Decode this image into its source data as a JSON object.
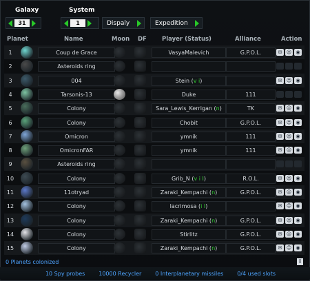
{
  "controls": {
    "galaxy_label": "Galaxy",
    "system_label": "System",
    "galaxy_value": "31",
    "system_value": "1",
    "display_label": "Dispaly",
    "expedition_label": "Expedition"
  },
  "headers": {
    "planet": "Planet",
    "name": "Name",
    "moon": "Moon",
    "df": "DF",
    "player": "Player (Status)",
    "alliance": "Alliance",
    "action": "Action"
  },
  "rows": [
    {
      "pos": "1",
      "name": "Coup de Grace",
      "moon": false,
      "player": "VasyaMalevich",
      "status": "",
      "alliance": "G.P.O.L.",
      "actions": true,
      "planet_color": "#6fd6d0"
    },
    {
      "pos": "2",
      "name": "Asteroids ring",
      "moon": false,
      "player": "",
      "status": "",
      "alliance": "",
      "actions": false,
      "planet_color": "#4a4a4a"
    },
    {
      "pos": "3",
      "name": "004",
      "moon": false,
      "player": "Stein",
      "status": "v i",
      "alliance": "",
      "actions": true,
      "planet_color": "#3d5a6a"
    },
    {
      "pos": "4",
      "name": "Tarsonis-13",
      "moon": true,
      "player": "Duke",
      "status": "",
      "alliance": "111",
      "actions": false,
      "planet_color": "#7dc4a2"
    },
    {
      "pos": "5",
      "name": "Colony",
      "moon": false,
      "player": "Sara_Lewis_Kerrigan",
      "status": "n",
      "alliance": "TK",
      "actions": true,
      "planet_color": "#4a6e5c"
    },
    {
      "pos": "6",
      "name": "Colony",
      "moon": false,
      "player": "Chobit",
      "status": "",
      "alliance": "G.P.O.L.",
      "actions": true,
      "planet_color": "#5aa27a"
    },
    {
      "pos": "7",
      "name": "Omicron",
      "moon": false,
      "player": "ymnik",
      "status": "",
      "alliance": "111",
      "actions": true,
      "planet_color": "#7fa6d8"
    },
    {
      "pos": "8",
      "name": "OmicronFAR",
      "moon": false,
      "player": "ymnik",
      "status": "",
      "alliance": "111",
      "actions": true,
      "planet_color": "#6fa07a"
    },
    {
      "pos": "9",
      "name": "Asteroids ring",
      "moon": false,
      "player": "",
      "status": "",
      "alliance": "",
      "actions": false,
      "planet_color": "#5a5040"
    },
    {
      "pos": "10",
      "name": "Colony",
      "moon": false,
      "player": "Grib_N",
      "status": "v i I",
      "alliance": "R.O.L.",
      "actions": true,
      "planet_color": "#3d4a52"
    },
    {
      "pos": "11",
      "name": "11otryad",
      "moon": false,
      "player": "Zaraki_Kempachi",
      "status": "n",
      "alliance": "G.P.O.L.",
      "actions": true,
      "planet_color": "#5b78c8"
    },
    {
      "pos": "12",
      "name": "Colony",
      "moon": false,
      "player": "lacrimosa",
      "status": "i I",
      "alliance": "",
      "actions": true,
      "planet_color": "#a4c2e0"
    },
    {
      "pos": "13",
      "name": "Colony",
      "moon": false,
      "player": "Zaraki_Kempachi",
      "status": "n",
      "alliance": "G.P.O.L.",
      "actions": true,
      "planet_color": "#1e3a5a"
    },
    {
      "pos": "14",
      "name": "Colony",
      "moon": false,
      "player": "Stirlitz",
      "status": "",
      "alliance": "G.P.O.L.",
      "actions": true,
      "planet_color": "#e4e4e8"
    },
    {
      "pos": "15",
      "name": "Colony",
      "moon": false,
      "player": "Zaraki_Kempachi",
      "status": "n",
      "alliance": "G.P.O.L.",
      "actions": true,
      "planet_color": "#c2cde6"
    }
  ],
  "footer": {
    "colonized": "0 Planets colonized",
    "info": "i",
    "spy_probes": "10 Spy probes",
    "recycler": "10000 Recycler",
    "missiles": "0 Interplanetary missiles",
    "slots": "0/4 used slots"
  },
  "action_icons": [
    "message-icon",
    "buddy-icon",
    "spy-icon"
  ]
}
